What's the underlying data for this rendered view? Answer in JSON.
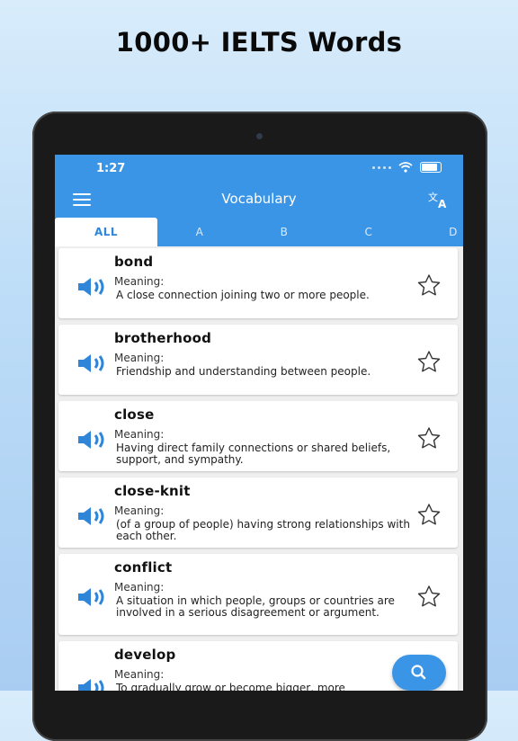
{
  "headline": "1000+ IELTS Words",
  "status": {
    "time": "1:27"
  },
  "appbar": {
    "title": "Vocabulary"
  },
  "tabs": [
    "ALL",
    "A",
    "B",
    "C",
    "D"
  ],
  "meaning_label": "Meaning:",
  "words": [
    {
      "word": "bond",
      "definition": "A close connection joining two or more people."
    },
    {
      "word": "brotherhood",
      "definition": "Friendship and understanding between people."
    },
    {
      "word": "close",
      "definition": "Having direct family connections or shared beliefs, support, and sympathy."
    },
    {
      "word": "close-knit",
      "definition": "(of a group of people) having strong relationships with each other."
    },
    {
      "word": "conflict",
      "definition": "A situation in which people, groups or countries are involved in a serious disagreement or argument."
    },
    {
      "word": "develop",
      "definition": "To gradually grow or become bigger, more"
    }
  ],
  "icons": {
    "menu": "menu-icon",
    "translate": "translate-icon",
    "speaker": "speaker-icon",
    "star": "star-outline-icon",
    "search": "search-icon"
  },
  "colors": {
    "accent": "#3a95e6",
    "background": "#efefef"
  }
}
